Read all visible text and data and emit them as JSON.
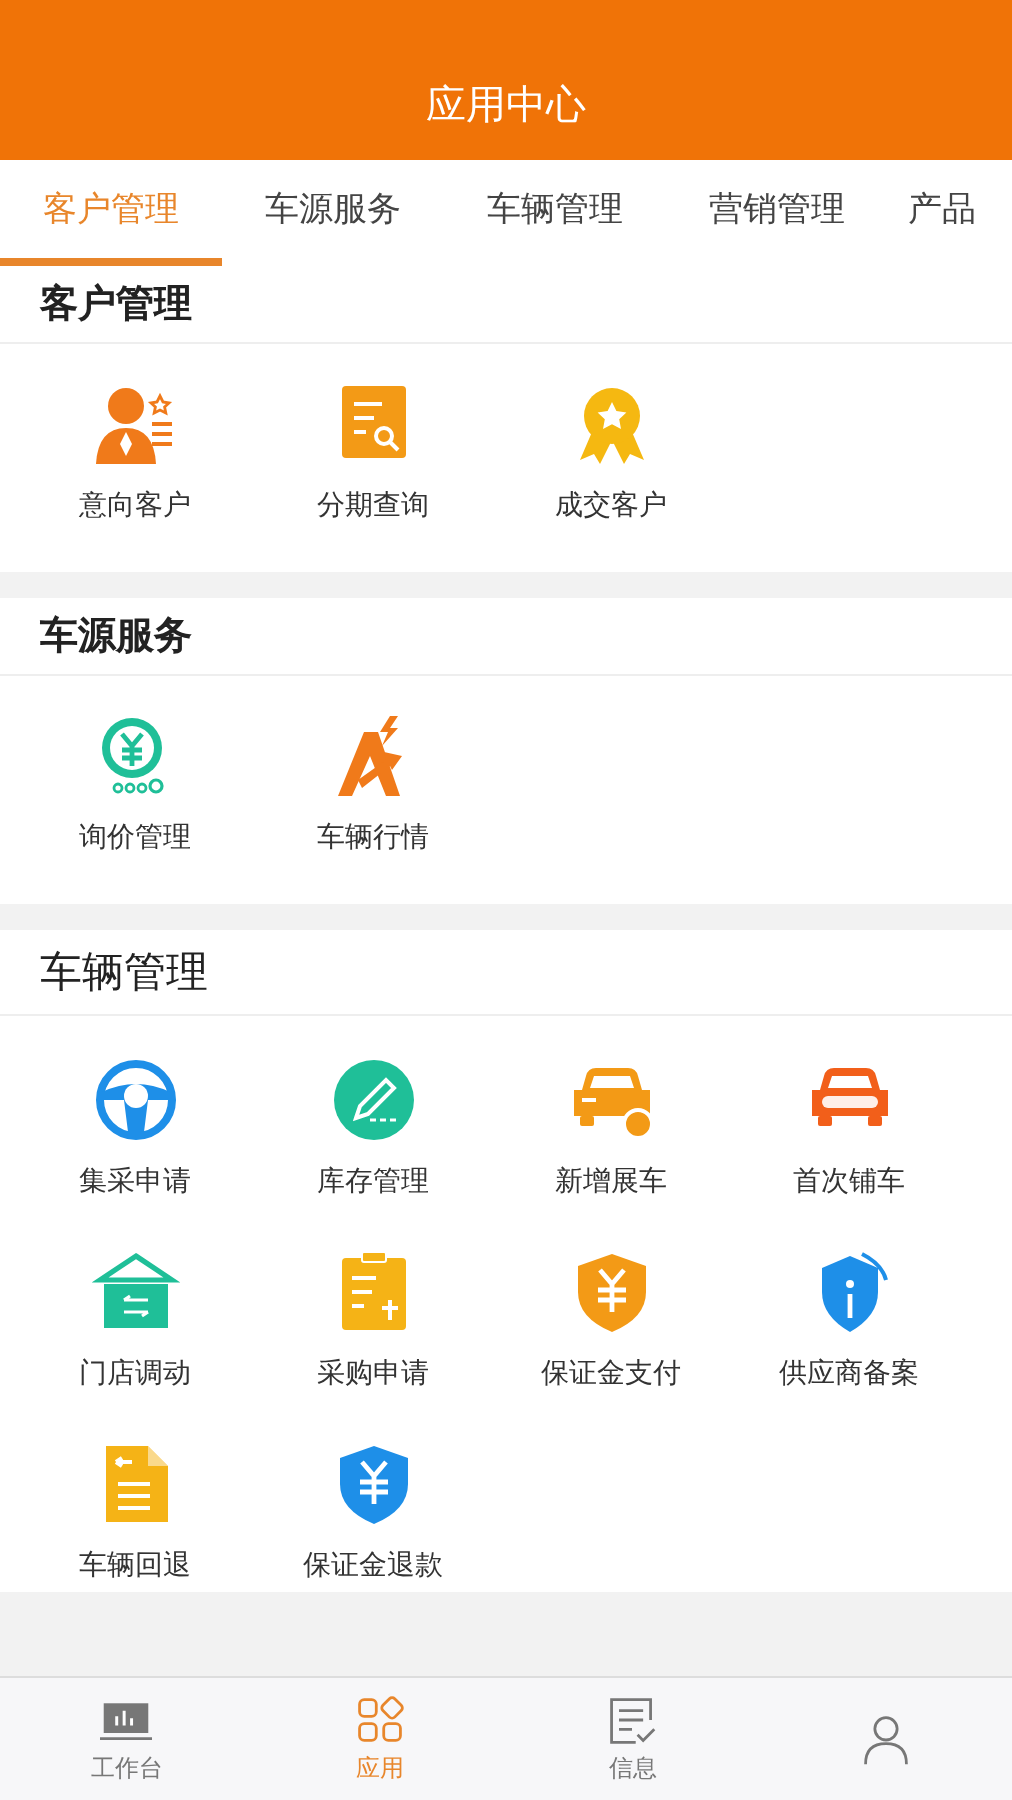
{
  "header": {
    "title": "应用中心"
  },
  "tabs": [
    {
      "label": "客户管理",
      "selected": true
    },
    {
      "label": "车源服务",
      "selected": false
    },
    {
      "label": "车辆管理",
      "selected": false
    },
    {
      "label": "营销管理",
      "selected": false
    },
    {
      "label": "产品",
      "selected": false
    }
  ],
  "sections": [
    {
      "title": "客户管理",
      "kind": "bold",
      "items": [
        {
          "label": "意向客户",
          "kind": "person"
        },
        {
          "label": "分期查询",
          "kind": "doc-search"
        },
        {
          "label": "成交客户",
          "kind": "medal"
        }
      ]
    },
    {
      "title": "车源服务",
      "kind": "bold",
      "items": [
        {
          "label": "询价管理",
          "kind": "coin"
        },
        {
          "label": "车辆行情",
          "kind": "spark-a"
        }
      ]
    },
    {
      "title": "车辆管理",
      "kind": "plain",
      "items": [
        {
          "label": "集采申请",
          "kind": "wheel"
        },
        {
          "label": "库存管理",
          "kind": "pencil"
        },
        {
          "label": "新增展车",
          "kind": "car-badge"
        },
        {
          "label": "首次铺车",
          "kind": "car-new"
        },
        {
          "label": "门店调动",
          "kind": "store"
        },
        {
          "label": "采购申请",
          "kind": "clipboard"
        },
        {
          "label": "保证金支付",
          "kind": "shield-orange"
        },
        {
          "label": "供应商备案",
          "kind": "shield-info"
        },
        {
          "label": "车辆回退",
          "kind": "doc-back"
        },
        {
          "label": "保证金退款",
          "kind": "shield-blue"
        }
      ]
    }
  ],
  "bottom_nav": [
    {
      "label": "工作台",
      "kind": "board",
      "selected": false
    },
    {
      "label": "应用",
      "kind": "apps",
      "selected": true
    },
    {
      "label": "信息",
      "kind": "note",
      "selected": false
    },
    {
      "kind": "user",
      "selected": false
    }
  ]
}
